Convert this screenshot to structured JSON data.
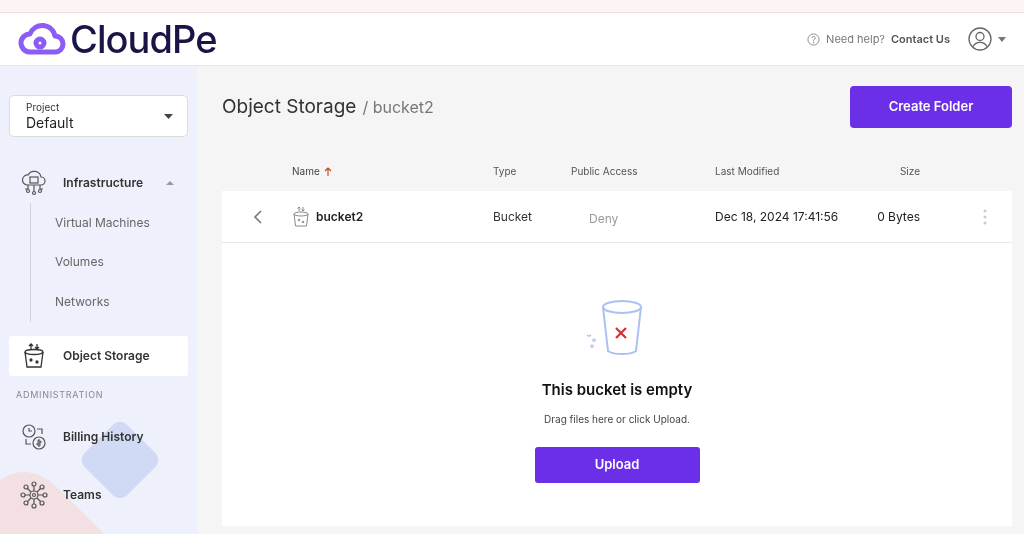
{
  "header": {
    "logo": "CloudPe",
    "help_prefix": "Need help?",
    "help_link": "Contact Us"
  },
  "sidebar": {
    "project": {
      "label": "Project",
      "value": "Default"
    },
    "items": [
      {
        "kind": "group",
        "label": "Infrastructure",
        "expanded": true,
        "selected": false,
        "children": [
          {
            "label": "Virtual Machines",
            "selected": false
          },
          {
            "label": "Volumes",
            "selected": false
          },
          {
            "label": "Networks",
            "selected": false
          }
        ]
      },
      {
        "kind": "item",
        "label": "Object Storage",
        "selected": true
      },
      {
        "kind": "section",
        "label": "ADMINISTRATION"
      },
      {
        "kind": "item",
        "label": "Billing History",
        "selected": false
      },
      {
        "kind": "item",
        "label": "Teams",
        "selected": false
      }
    ]
  },
  "page": {
    "title": "Object Storage",
    "crumb": "/ bucket2",
    "action": "Create Folder"
  },
  "table": {
    "columns": [
      {
        "label": "Name",
        "sorted": true
      },
      {
        "label": "Type",
        "sorted": false
      },
      {
        "label": "Public Access",
        "sorted": false
      },
      {
        "label": "Last Modified",
        "sorted": false
      },
      {
        "label": "Size",
        "sorted": false
      }
    ],
    "rows": [
      {
        "name": "bucket2",
        "type": "Bucket",
        "public_access": "Deny",
        "last_modified": "Dec 18, 2024 17:41:56",
        "size": "0 Bytes"
      }
    ]
  },
  "empty": {
    "title": "This bucket is empty",
    "text": "Drag files here or click Upload.",
    "button": "Upload"
  }
}
